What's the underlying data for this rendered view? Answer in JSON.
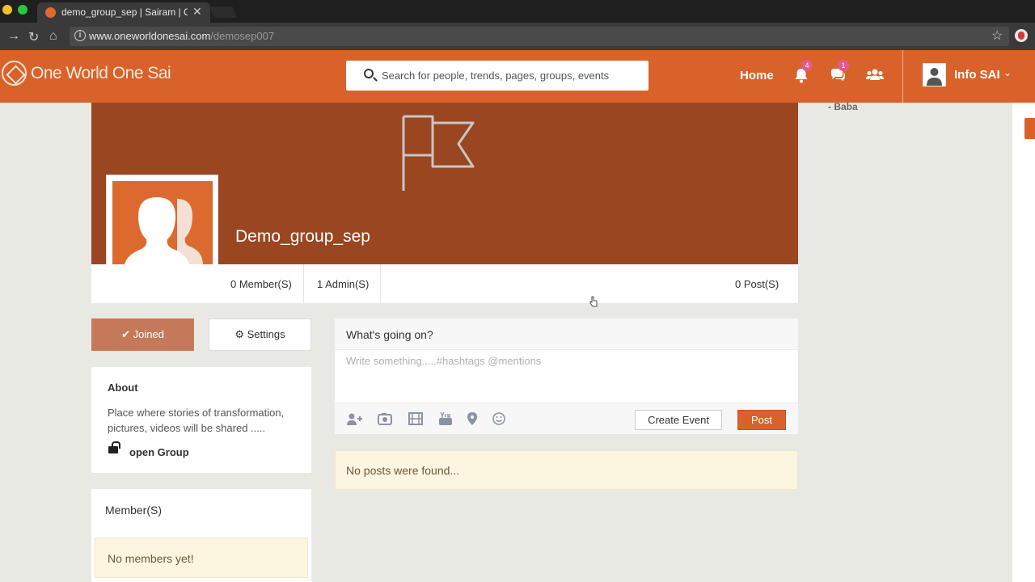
{
  "browser": {
    "tab_title": "demo_group_sep | Sairam | On",
    "url_host": "www.oneworldonesai.com",
    "url_path": "/demosep007"
  },
  "header": {
    "logo_text": "One World One Sai",
    "search_placeholder": "Search for people, trends, pages, groups, events",
    "home_label": "Home",
    "notifications_count": "4",
    "messages_count": "1",
    "user_name": "Info SAI",
    "brand_color": "#d9622a"
  },
  "sidebar_right": {
    "quote_source": "- Baba"
  },
  "group": {
    "name": "Demo_group_sep",
    "members_stat": "0 Member(S)",
    "admins_stat": "1 Admin(S)",
    "posts_stat": "0 Post(S)",
    "joined_label": "Joined",
    "settings_label": "Settings",
    "about_title": "About",
    "about_description": "Place where stories of transformation, pictures, videos will be shared .....",
    "group_type": "open Group",
    "members_title": "Member(S)",
    "members_empty": "No members yet!"
  },
  "composer": {
    "title": "What's going on?",
    "placeholder": "Write something.....#hashtags @mentions",
    "create_event_label": "Create Event",
    "post_label": "Post"
  },
  "feed": {
    "empty_message": "No posts were found..."
  }
}
